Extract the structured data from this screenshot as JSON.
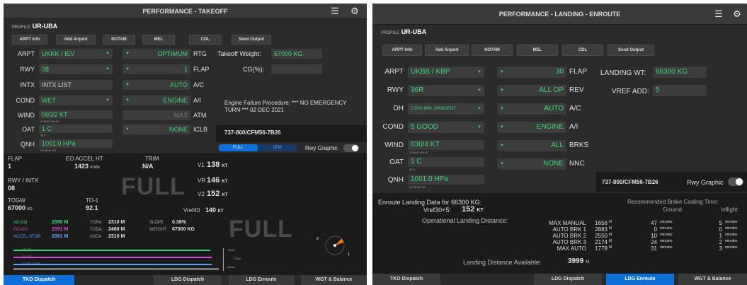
{
  "left": {
    "title": "PERFORMANCE - TAKEOFF",
    "profile_label": "PROFILE",
    "profile_value": "UR-UBA",
    "buttons": [
      "ARPT Info",
      "Add Airport",
      "NOTAM",
      "MEL",
      "CDL",
      "Send Output"
    ],
    "arpt": {
      "label": "ARPT",
      "value": "UKKK / IEV"
    },
    "rwy": {
      "label": "RWY",
      "value": "08"
    },
    "intx": {
      "label": "INTX",
      "value": "INTX LIST"
    },
    "cond": {
      "label": "COND",
      "value": "WET"
    },
    "wind": {
      "label": "WIND",
      "value": "060/2 KT",
      "sub": "2 HW/2 XW KT"
    },
    "oat": {
      "label": "OAT",
      "value": "1 C",
      "sub": "34 F"
    },
    "qnh": {
      "label": "QNH",
      "value": "1001.0 HPa",
      "sub": "29.56 IN HG"
    },
    "rtg": {
      "value": "OPTIMUM",
      "label": "RTG"
    },
    "flap": {
      "value": "1",
      "label": "FLAP"
    },
    "ac": {
      "value": "AUTO",
      "label": "A/C"
    },
    "ai": {
      "value": "ENGINE",
      "label": "A/I"
    },
    "atm": {
      "value": "MAX",
      "label": "ATM"
    },
    "iclb": {
      "value": "NONE",
      "label": "ICLB"
    },
    "tow_label": "Takeoff Weight:",
    "tow_value": "67000 KG",
    "cg_label": "CG(%):",
    "efp": "Engine Failure Procedure:   *** NO EMERGENCY TURN *** 02 DEC 2021",
    "aircraft": "737-800/CFM56-7B26",
    "seg": [
      "FULL",
      "ATM"
    ],
    "rwy_graphic": "Rwy Graphic",
    "flap_hdr": "FLAP",
    "flap_val": "1",
    "eo_hdr": "EO ACCEL HT",
    "eo_val": "1423",
    "eo_unit": "ft MSL",
    "trim_hdr": "TRIM",
    "trim_val": "N/A",
    "rwyintx_hdr": "RWY / INTX",
    "rwyintx_val": "08",
    "full_big": "FULL",
    "togw_hdr": "TOGW",
    "togw_val": "67000",
    "togw_unit": "KG",
    "to1_hdr": "TO-1",
    "to1_val": "92.1",
    "v1": {
      "label": "V1",
      "value": "138",
      "unit": "KT"
    },
    "vr": {
      "label": "VR",
      "value": "146",
      "unit": "KT"
    },
    "v2": {
      "label": "V2",
      "value": "152",
      "unit": "KT"
    },
    "vref40": {
      "label": "Vref40",
      "value": "140",
      "unit": "KT"
    },
    "ae_go": {
      "label": "AE-GO",
      "value": "2080 M"
    },
    "eo_go": {
      "label": "EO-GO",
      "value": "2091 M"
    },
    "accel_stop": {
      "label": "ACCEL-STOP",
      "value": "2091 M"
    },
    "tora": {
      "label": "TORA",
      "value": "2310 M"
    },
    "toda": {
      "label": "TODA",
      "value": "2460 M"
    },
    "asda": {
      "label": "ASDA",
      "value": "2310 M"
    },
    "slope": {
      "label": "SLOPE",
      "value": "0.38%"
    },
    "weight": {
      "label": "WEIGHT",
      "value": "67000 KG"
    },
    "full_big2": "FULL",
    "bar_labels": [
      "AE-GO",
      "EO-GO",
      "ACCEL-STOP"
    ],
    "side_labels": [
      "TORA",
      "TODA",
      "ASDA"
    ],
    "wind_small": [
      "2",
      "1"
    ],
    "tabs": [
      "TKO Dispatch",
      "LDG Dispatch",
      "LDG Enroute",
      "WGT & Balance"
    ]
  },
  "right": {
    "title": "PERFORMANCE - LANDING - ENROUTE",
    "profile_label": "PROFILE",
    "profile_value": "UR-UBA",
    "buttons": [
      "ARPT Info",
      "Add Airport",
      "NOTAM",
      "MEL",
      "CDL",
      "Send Output"
    ],
    "arpt": {
      "label": "ARPT",
      "value": "UKBB / KBP"
    },
    "rwy": {
      "label": "RWY",
      "value": "36R"
    },
    "dh": {
      "label": "DH",
      "value": "2.50% MIN. GRADIENT"
    },
    "cond": {
      "label": "COND",
      "value": "5 GOOD"
    },
    "wind": {
      "label": "WIND",
      "value": "030/4 KT",
      "sub": "3 HW/2 XW KT"
    },
    "oat": {
      "label": "OAT",
      "value": "1 C",
      "sub": "34 F"
    },
    "qnh": {
      "label": "QNH",
      "value": "1001.0 HPa",
      "sub": "29.56 IN HG"
    },
    "flap": {
      "value": "30",
      "label": "FLAP"
    },
    "rev": {
      "value": "ALL OP",
      "label": "REV"
    },
    "ac": {
      "value": "AUTO",
      "label": "A/C"
    },
    "ai": {
      "value": "ENGINE",
      "label": "A/I"
    },
    "brks": {
      "value": "ALL",
      "label": "BRKS"
    },
    "nnc": {
      "value": "NONE",
      "label": "NNC"
    },
    "lw_label": "LANDING WT:",
    "lw_value": "66300 KG",
    "vref_label": "VREF ADD:",
    "vref_value": "5",
    "aircraft": "737-800/CFM56-7B26",
    "rwy_graphic": "Rwy Graphic",
    "data_title": "Enroute Landing Data for 66300 KG:",
    "vref_line_label": "Vref30+5:",
    "vref_line_value": "152",
    "vref_line_unit": "KT",
    "opdist_label": "Operational Landing Distance:",
    "rows": [
      {
        "name": "MAX MANUAL",
        "dist": "1656",
        "g": "47",
        "i": "5"
      },
      {
        "name": "AUTO BRK 1",
        "dist": "2883",
        "g": "0",
        "i": "0"
      },
      {
        "name": "AUTO BRK 2",
        "dist": "2550",
        "g": "10",
        "i": "1"
      },
      {
        "name": "AUTO BRK 3",
        "dist": "2174",
        "g": "24",
        "i": "2"
      },
      {
        "name": "MAX AUTO",
        "dist": "1778",
        "g": "31",
        "i": "3"
      }
    ],
    "unit_m": "M",
    "unit_min": "minutes",
    "cool_title": "Recommended Brake Cooling Time:",
    "ground_hdr": "Ground:",
    "inflight_hdr": "Inflight:",
    "lda_label": "Landing Distance Available:",
    "lda_value": "3999",
    "lda_unit": "M",
    "tabs": [
      "TKO Dispatch",
      "LDG Dispatch",
      "LDG Enroute",
      "WGT & Balance"
    ]
  }
}
